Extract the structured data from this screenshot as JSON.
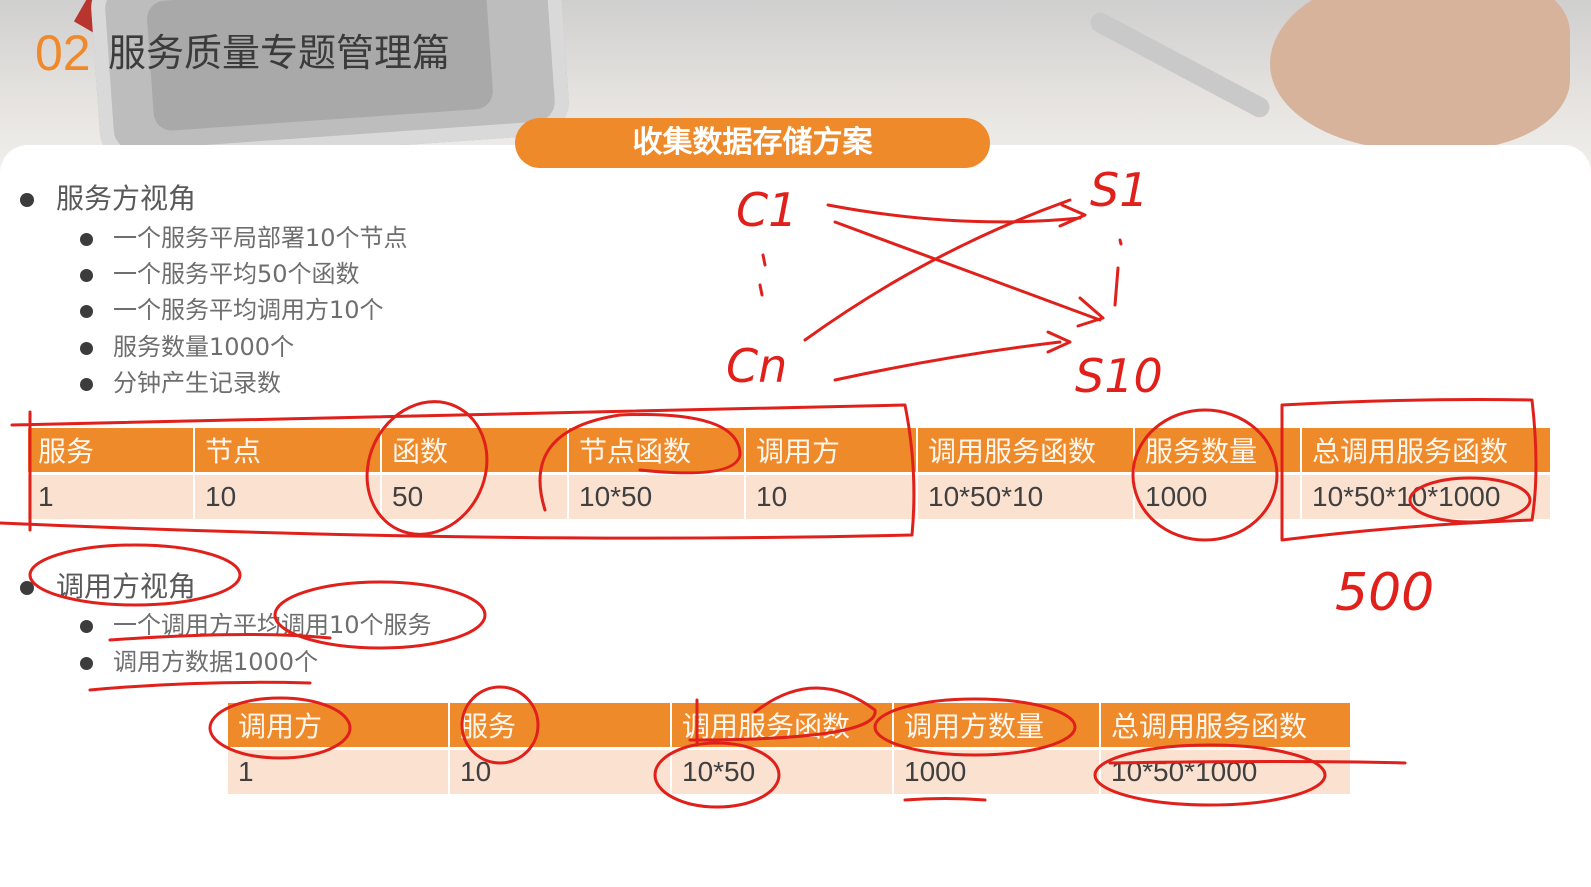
{
  "slide": {
    "section_number": "02",
    "section_title": "服务质量专题管理篇",
    "heading": "收集数据存储方案"
  },
  "provider_view": {
    "title": "服务方视角",
    "items": [
      "一个服务平局部署10个节点",
      "一个服务平均50个函数",
      "一个服务平均调用方10个",
      "服务数量1000个",
      "分钟产生记录数"
    ]
  },
  "table1": {
    "headers": [
      "服务",
      "节点",
      "函数",
      "节点函数",
      "调用方",
      "调用服务函数",
      "服务数量",
      "总调用服务函数"
    ],
    "row": [
      "1",
      "10",
      "50",
      "10*50",
      "10",
      "10*50*10",
      "1000",
      "10*50*10*1000"
    ]
  },
  "caller_view": {
    "title": "调用方视角",
    "items": [
      "一个调用方平均调用10个服务",
      "调用方数据1000个"
    ]
  },
  "table2": {
    "headers": [
      "调用方",
      "服务",
      "调用服务函数",
      "调用方数量",
      "总调用服务函数"
    ],
    "row": [
      "1",
      "10",
      "10*50",
      "1000",
      "10*50*1000"
    ]
  },
  "handwriting": {
    "label_c1": "C1",
    "label_cn": "Cn",
    "label_s1": "S1",
    "label_s10": "S10",
    "note_500": "500"
  },
  "colors": {
    "accent_orange": "#ef8a2a",
    "cell_fill": "#fbe1cf",
    "ink_red": "#e0201b"
  }
}
